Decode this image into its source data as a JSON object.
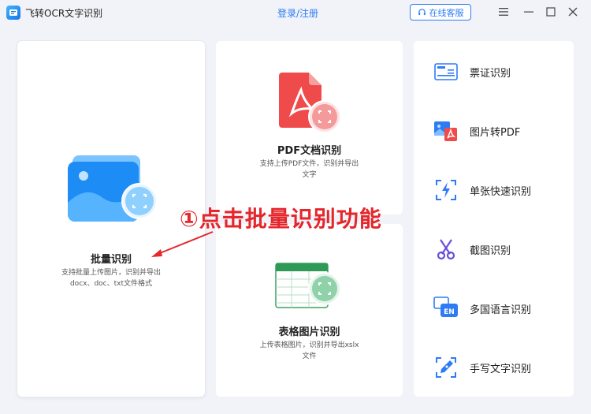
{
  "titlebar": {
    "app_title": "飞转OCR文字识别",
    "login_link": "登录/注册",
    "service_button": "在线客服"
  },
  "batch_card": {
    "title": "批量识别",
    "desc_line1": "支持批量上传图片，识别并导出",
    "desc_line2": "docx、doc、txt文件格式"
  },
  "pdf_card": {
    "title": "PDF文档识别",
    "desc_line1": "支持上传PDF文件，识别并导出",
    "desc_line2": "文字"
  },
  "table_card": {
    "title": "表格图片识别",
    "desc_line1": "上传表格图片，识别并导出xslx",
    "desc_line2": "文件"
  },
  "sidebar": {
    "items": [
      {
        "label": "票证识别",
        "icon": "id-card-icon"
      },
      {
        "label": "图片转PDF",
        "icon": "image-to-pdf-icon"
      },
      {
        "label": "单张快速识别",
        "icon": "lightning-scan-icon"
      },
      {
        "label": "截图识别",
        "icon": "scissors-icon"
      },
      {
        "label": "多国语言识别",
        "icon": "language-en-icon"
      },
      {
        "label": "手写文字识别",
        "icon": "handwriting-pen-icon"
      }
    ]
  },
  "annotation": {
    "text": "①点击批量识别功能"
  },
  "colors": {
    "accent": "#2d7cf6",
    "annotation_red": "#e5262b",
    "background": "#f1f3f8"
  }
}
